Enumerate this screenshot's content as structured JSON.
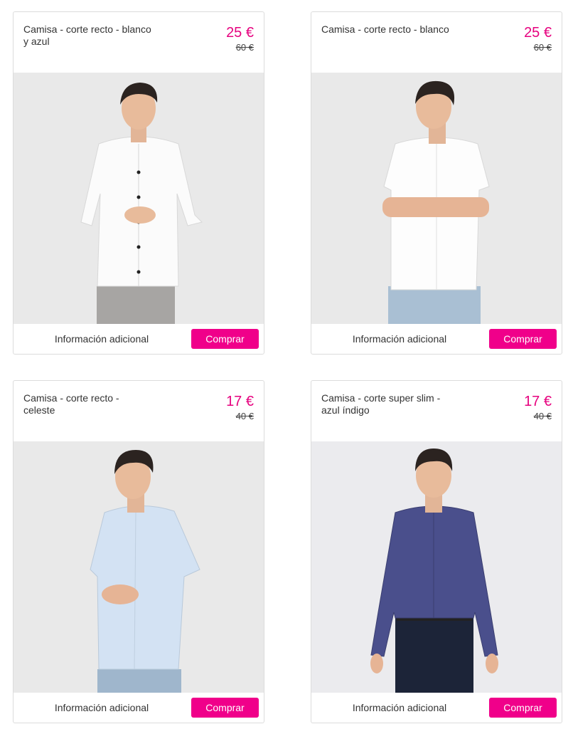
{
  "products": [
    {
      "title": "Camisa - corte recto - blanco y azul",
      "price": "25 €",
      "old_price": "60 €",
      "image_alt": "white-shirt-model",
      "info_label": "Información adicional",
      "buy_label": "Comprar",
      "shirt_color": "#fbfbfb",
      "pants_color": "#a7a5a3"
    },
    {
      "title": "Camisa - corte recto - blanco",
      "price": "25 €",
      "old_price": "60 €",
      "image_alt": "white-short-sleeve-shirt-model",
      "info_label": "Información adicional",
      "buy_label": "Comprar",
      "shirt_color": "#fdfdfd",
      "pants_color": "#a9bfd3"
    },
    {
      "title": "Camisa - corte recto - celeste",
      "price": "17 €",
      "old_price": "40 €",
      "image_alt": "light-blue-shirt-model",
      "info_label": "Información adicional",
      "buy_label": "Comprar",
      "shirt_color": "#d3e2f3",
      "pants_color": "#9fb6cc"
    },
    {
      "title": "Camisa - corte super slim - azul índigo",
      "price": "17 €",
      "old_price": "40 €",
      "image_alt": "indigo-shirt-model",
      "info_label": "Información adicional",
      "buy_label": "Comprar",
      "shirt_color": "#4a4f8c",
      "pants_color": "#1c2438"
    }
  ],
  "colors": {
    "accent": "#e6007e",
    "button": "#f0008a",
    "border": "#dcdcdc"
  }
}
